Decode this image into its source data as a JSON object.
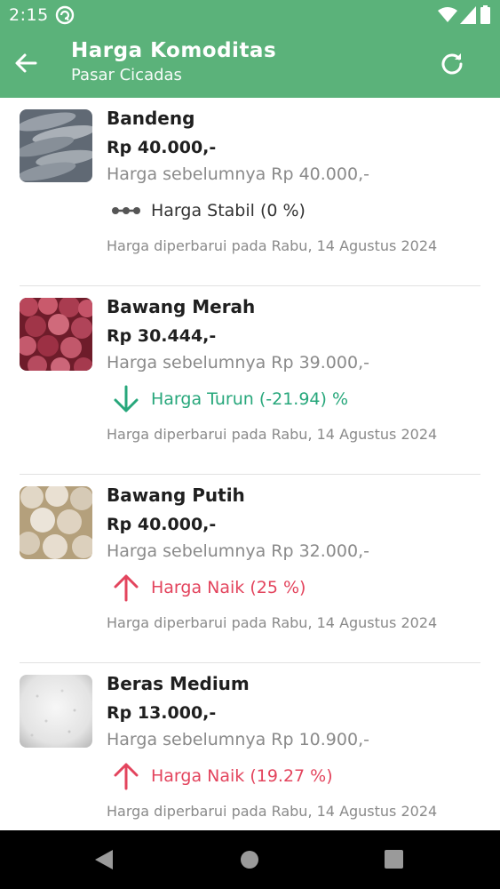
{
  "status_bar": {
    "time": "2:15",
    "icons": [
      "sync-icon",
      "wifi-icon",
      "cellular-icon",
      "battery-icon"
    ]
  },
  "app_bar": {
    "title": "Harga Komoditas",
    "subtitle": "Pasar Cicadas",
    "back_icon": "arrow-left-icon",
    "refresh_icon": "refresh-icon"
  },
  "colors": {
    "primary": "#5bb27a",
    "down": "#27a77b",
    "up": "#e3445d",
    "stable": "#555555"
  },
  "items": [
    {
      "name": "Bandeng",
      "price": "Rp 40.000,-",
      "previous": "Harga sebelumnya Rp 40.000,-",
      "trend": "stable",
      "trend_text": "Harga Stabil (0 %)",
      "updated": "Harga diperbarui pada Rabu, 14 Agustus 2024",
      "image": "milkfish-photo"
    },
    {
      "name": "Bawang Merah",
      "price": "Rp 30.444,-",
      "previous": "Harga sebelumnya Rp 39.000,-",
      "trend": "down",
      "trend_text": "Harga Turun (-21.94) %",
      "updated": "Harga diperbarui pada Rabu, 14 Agustus 2024",
      "image": "shallot-photo"
    },
    {
      "name": "Bawang Putih",
      "price": "Rp 40.000,-",
      "previous": "Harga sebelumnya Rp 32.000,-",
      "trend": "up",
      "trend_text": "Harga Naik (25 %)",
      "updated": "Harga diperbarui pada Rabu, 14 Agustus 2024",
      "image": "garlic-photo"
    },
    {
      "name": "Beras Medium",
      "price": "Rp 13.000,-",
      "previous": "Harga sebelumnya Rp 10.900,-",
      "trend": "up",
      "trend_text": "Harga Naik (19.27 %)",
      "updated": "Harga diperbarui pada Rabu, 14 Agustus 2024",
      "image": "rice-photo"
    }
  ],
  "nav_bar": {
    "icons": [
      "nav-back-icon",
      "nav-home-icon",
      "nav-recents-icon"
    ]
  }
}
